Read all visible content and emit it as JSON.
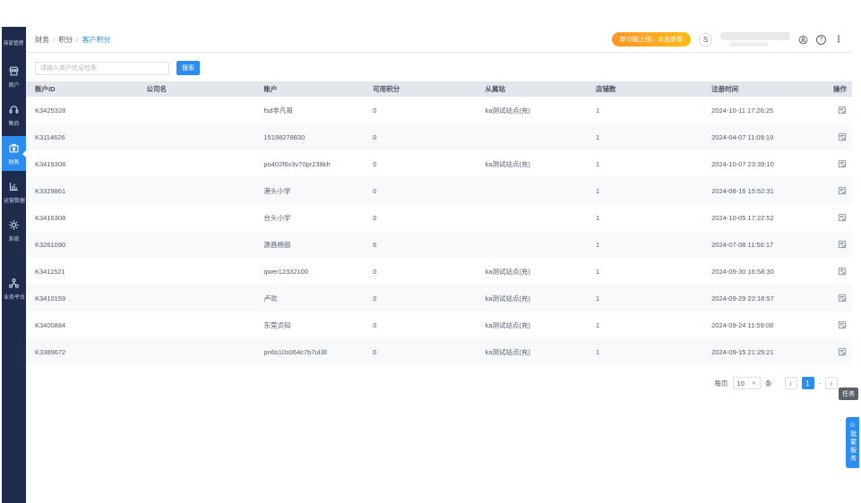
{
  "colors": {
    "accent": "#2d8cf0",
    "sidebar_bg": "#1f2b4d",
    "promo_gradient_start": "#ff9526",
    "promo_gradient_end": "#ffbb17",
    "table_header_bg": "#e3e6ec",
    "row_stripe": "#f8f9fb",
    "task_tag_bg": "#5b6069"
  },
  "sidebar": {
    "logo_text": "商家管理",
    "items": [
      {
        "key": "merchant",
        "label": "商户",
        "icon": "storefront-icon",
        "active": false
      },
      {
        "key": "aftersale",
        "label": "售后",
        "icon": "headset-icon",
        "active": false
      },
      {
        "key": "finance",
        "label": "财务",
        "icon": "finance-icon",
        "active": true
      },
      {
        "key": "operations",
        "label": "运营数据",
        "icon": "chart-icon",
        "active": false
      },
      {
        "key": "system",
        "label": "系统",
        "icon": "gear-icon",
        "active": false
      },
      {
        "key": "platform",
        "label": "业务平台",
        "icon": "org-icon",
        "active": false
      }
    ]
  },
  "header": {
    "breadcrumb": [
      "财务",
      "积分",
      "客户积分"
    ],
    "crumb_separator": "/",
    "promo_badge": "新功能上线，点击查看",
    "avatar_text": "S",
    "help_glyph": "?",
    "more_glyph": "⋮"
  },
  "search": {
    "placeholder": "请输入商户信息检索",
    "button": "搜索"
  },
  "table": {
    "columns": [
      "账户ID",
      "公司名",
      "账户",
      "可用积分",
      "从属站",
      "店铺数",
      "注册时间",
      "操作"
    ],
    "rows": [
      [
        "K3425328",
        "",
        "fsd非凡哥",
        "0",
        "ka测试站点(充)",
        "1",
        "2024-10-11 17:26:25"
      ],
      [
        "K3114626",
        "",
        "15198278830",
        "0",
        "",
        "1",
        "2024-04-07 11:09:19"
      ],
      [
        "K3419308",
        "",
        "po402f6v3v70pr238kh",
        "0",
        "ka测试站点(充)",
        "1",
        "2024-10-07 23:39:10"
      ],
      [
        "K3329861",
        "",
        "港头小学",
        "0",
        "",
        "1",
        "2024-08-16 15:52:31"
      ],
      [
        "K3416308",
        "",
        "台头小学",
        "0",
        "",
        "1",
        "2024-10-05 17:22:52"
      ],
      [
        "K3261090",
        "",
        "源昌杨丽",
        "0",
        "",
        "1",
        "2024-07-08 11:56:17"
      ],
      [
        "K3411521",
        "",
        "qwer12332100",
        "0",
        "ka测试站点(充)",
        "1",
        "2024-09-30 16:58:30"
      ],
      [
        "K3410159",
        "",
        "卢欢",
        "0",
        "ka测试站点(充)",
        "1",
        "2024-09-29 22:18:57"
      ],
      [
        "K3400884",
        "",
        "东莞贞知",
        "0",
        "ka测试站点(充)",
        "1",
        "2024-09-24 11:59:08"
      ],
      [
        "K3389672",
        "",
        "pn6s10s064c7b7ul3ll",
        "0",
        "ka测试站点(充)",
        "1",
        "2024-09-15 21:25:21"
      ]
    ]
  },
  "pagination": {
    "per_page_label": "每页",
    "per_page_value": "10",
    "per_page_unit": "条",
    "prev_label": "‹",
    "page": "1",
    "separator": "-",
    "next_label": "›"
  },
  "floating": {
    "task_tooltip": "任务",
    "service_smiley": "☺",
    "service_button": "我要服务"
  }
}
